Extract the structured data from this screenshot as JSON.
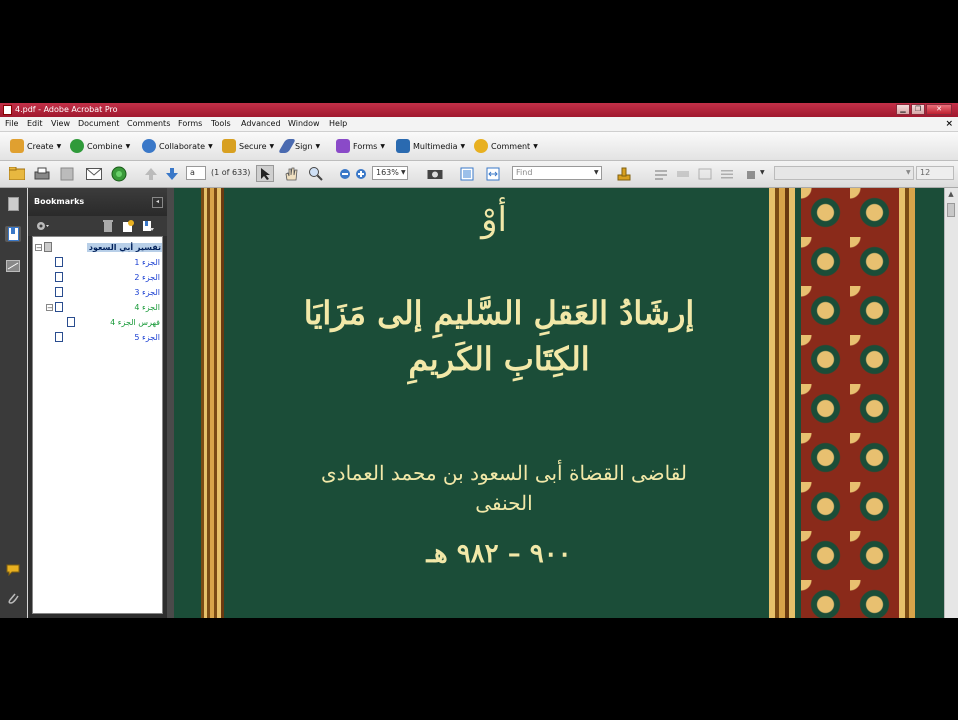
{
  "window": {
    "title": "4.pdf - Adobe Acrobat Pro"
  },
  "window_controls": {
    "minimize": "▁",
    "restore": "❐",
    "close": "✕"
  },
  "menu": [
    "File",
    "Edit",
    "View",
    "Document",
    "Comments",
    "Forms",
    "Tools",
    "Advanced",
    "Window",
    "Help"
  ],
  "menu_close": "×",
  "tasks": [
    {
      "label": "Create",
      "color": "#e0a030"
    },
    {
      "label": "Combine",
      "color": "#2f9a3a"
    },
    {
      "label": "Collaborate",
      "color": "#3a78c8"
    },
    {
      "label": "Secure",
      "color": "#d8a020"
    },
    {
      "label": "Sign",
      "color": "#4a6ab0"
    },
    {
      "label": "Forms",
      "color": "#8a4ac8"
    },
    {
      "label": "Multimedia",
      "color": "#2a6ab0"
    },
    {
      "label": "Comment",
      "color": "#e8b020"
    }
  ],
  "nav": {
    "page_input": "a",
    "page_count": "(1 of 633)",
    "zoom": "163%",
    "find_placeholder": "Find",
    "font_size": "12"
  },
  "bookmarks": {
    "title": "Bookmarks",
    "items": [
      {
        "label": "تفسير أبي السعود",
        "selected": true
      },
      {
        "label": "الجزء 1"
      },
      {
        "label": "الجزء 2"
      },
      {
        "label": "الجزء 3"
      },
      {
        "label": "الجزء 4",
        "expanded": true
      },
      {
        "label": "فهرس الجزء 4"
      },
      {
        "label": "الجزء 5"
      }
    ]
  },
  "document": {
    "line1": "أوْ",
    "line2": "إرشَادُ العَقلِ السَّليمِ إلى مَزَايَا الكِتَابِ الكَريمِ",
    "line3": "لقاضى القضاة أبى السعود بن محمد العمادى الحنفى",
    "line4": "٩٠٠ – ٩٨٢ هـ"
  }
}
